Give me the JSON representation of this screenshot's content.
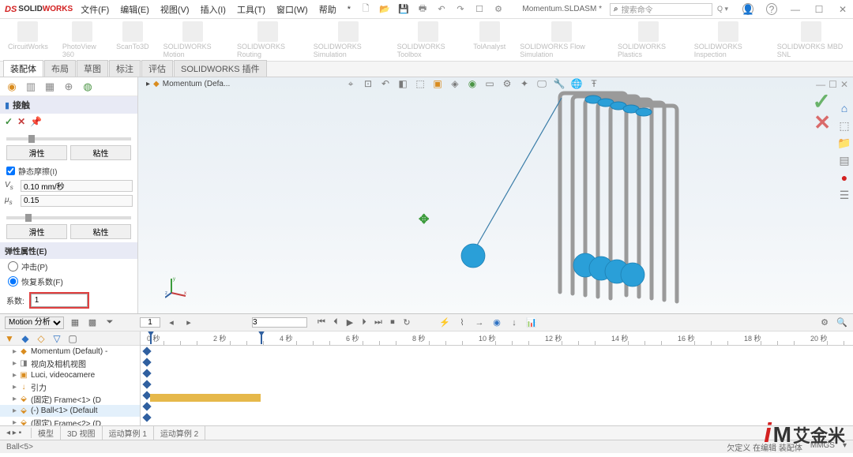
{
  "app": {
    "logo_prefix": "DS",
    "logo_name_a": "SOLID",
    "logo_name_b": "WORKS"
  },
  "menus": [
    "文件(F)",
    "编辑(E)",
    "视图(V)",
    "插入(I)",
    "工具(T)",
    "窗口(W)",
    "帮助",
    "*"
  ],
  "title_file": "Momentum.SLDASM *",
  "search_placeholder": "搜索命令",
  "search_icon": "⌕",
  "ribbon": [
    "CircuitWorks",
    "PhotoView 360",
    "ScanTo3D",
    "SOLIDWORKS Motion",
    "SOLIDWORKS Routing",
    "SOLIDWORKS Simulation",
    "SOLIDWORKS Toolbox",
    "TolAnalyst",
    "SOLIDWORKS Flow Simulation",
    "SOLIDWORKS Plastics",
    "SOLIDWORKS Inspection",
    "SOLIDWORKS MBD SNL"
  ],
  "tabs": [
    "装配体",
    "布局",
    "草图",
    "标注",
    "评估",
    "SOLIDWORKS 插件"
  ],
  "panel": {
    "title": "接触",
    "btn_slip": "滑性",
    "btn_visc": "粘性",
    "static_fric_label": "静态摩擦(I)",
    "vs_value": "0.10 mm/秒",
    "mu_value": "0.15",
    "section_elastic": "弹性属性(E)",
    "opt_impact": "冲击(P)",
    "opt_restore": "恢复系数(F)",
    "coef_label": "系数:",
    "coef_value": "1"
  },
  "canvas": {
    "crumb": "Momentum (Defa..."
  },
  "motion": {
    "dropdown": "Motion 分析",
    "key_value": "1",
    "time_value": "3"
  },
  "timeline": {
    "ticks": [
      "0 秒",
      "2 秒",
      "4 秒",
      "6 秒",
      "8 秒",
      "10 秒",
      "12 秒",
      "14 秒",
      "16 秒",
      "18 秒",
      "20 秒"
    ],
    "tree": [
      {
        "label": "Momentum (Default) -",
        "icon": "◆",
        "color": "#d98c1f",
        "sel": false
      },
      {
        "label": "视向及相机视图",
        "icon": "◨",
        "color": "#7a7a7a",
        "sel": false
      },
      {
        "label": "Luci, videocamere",
        "icon": "▣",
        "color": "#d98c1f",
        "sel": false
      },
      {
        "label": "引力",
        "icon": "↓",
        "color": "#d98c1f",
        "sel": false
      },
      {
        "label": "(固定) Frame<1> (D",
        "icon": "⬙",
        "color": "#d98c1f",
        "sel": false
      },
      {
        "label": "(-) Ball<1> (Default",
        "icon": "⬙",
        "color": "#d98c1f",
        "sel": true
      },
      {
        "label": "(固定) Frame<2> (D",
        "icon": "⬙",
        "color": "#d98c1f",
        "sel": false
      }
    ]
  },
  "bottom_tabs": [
    "模型",
    "3D 视图",
    "运动算例 1",
    "运动算例 2"
  ],
  "status": {
    "left": "Ball<5>",
    "mid": "欠定义  在编辑 装配体",
    "right": "MMGS"
  },
  "watermark": {
    "i": "i",
    "m": "M",
    "cn": "艾金米"
  }
}
